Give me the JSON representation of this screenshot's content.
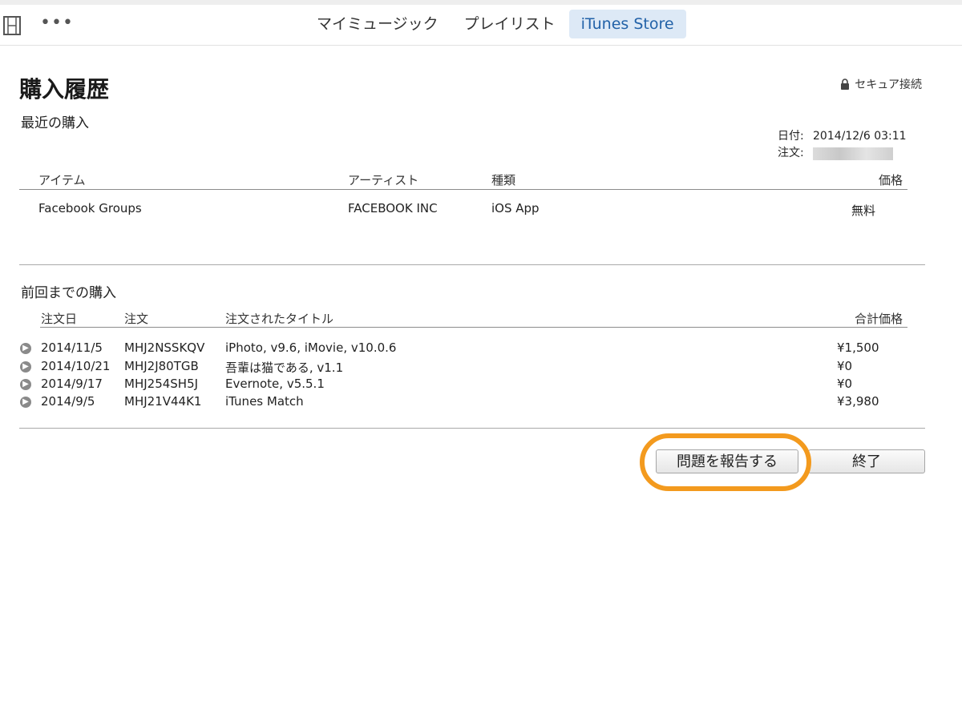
{
  "toolbar": {
    "more_label": "•••",
    "tabs": [
      {
        "label": "マイミュージック"
      },
      {
        "label": "プレイリスト"
      },
      {
        "label": "iTunes Store"
      }
    ]
  },
  "page": {
    "title": "購入履歴",
    "secure_label": "セキュア接続"
  },
  "recent": {
    "title": "最近の購入",
    "date_label": "日付:",
    "date_value": "2014/12/6 03:11",
    "order_label": "注文:",
    "headers": {
      "item": "アイテム",
      "artist": "アーティスト",
      "kind": "種類",
      "price": "価格"
    },
    "rows": [
      {
        "item": "Facebook Groups",
        "artist": "FACEBOOK INC",
        "kind": "iOS App",
        "price": "無料"
      }
    ]
  },
  "previous": {
    "title": "前回までの購入",
    "headers": {
      "date": "注文日",
      "order": "注文",
      "titles": "注文されたタイトル",
      "total": "合計価格"
    },
    "rows": [
      {
        "date": "2014/11/5",
        "order": "MHJ2NSSKQV",
        "titles": "iPhoto, v9.6, iMovie, v10.0.6",
        "total": "¥1,500"
      },
      {
        "date": "2014/10/21",
        "order": "MHJ2J80TGB",
        "titles": "吾輩は猫である, v1.1",
        "total": "¥0"
      },
      {
        "date": "2014/9/17",
        "order": "MHJ254SH5J",
        "titles": "Evernote, v5.5.1",
        "total": "¥0"
      },
      {
        "date": "2014/9/5",
        "order": "MHJ21V44K1",
        "titles": "iTunes Match",
        "total": "¥3,980"
      }
    ]
  },
  "buttons": {
    "report": "問題を報告する",
    "done": "終了"
  },
  "colors": {
    "highlight_ring": "#f39a1e",
    "active_tab_bg": "#dde9f6",
    "active_tab_text": "#2262a8"
  },
  "icons": {
    "sidebar_toggle": "film-icon",
    "more": "more-icon",
    "secure": "lock-icon",
    "row_detail": "arrow-right-circle-icon"
  }
}
